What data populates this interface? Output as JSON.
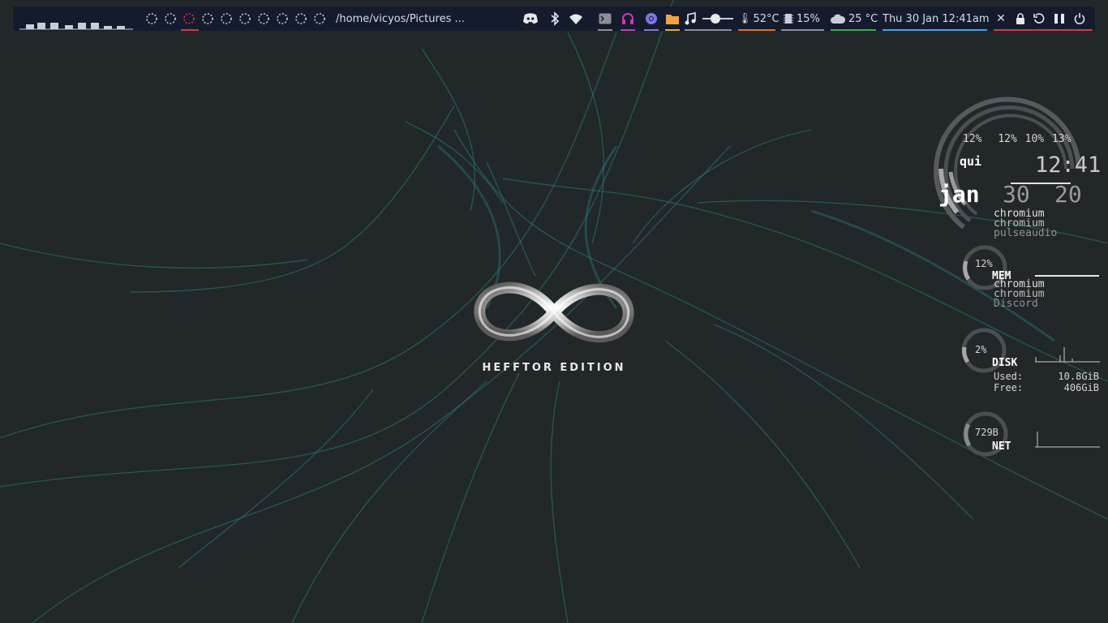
{
  "colors": {
    "bar_bg": "#141b2d",
    "accent_red": "#e0334a",
    "accent_orange": "#e8711f",
    "accent_green": "#3cb043",
    "accent_blue": "#3ea8e6",
    "accent_purple": "#7c78e6",
    "accent_magenta": "#c83cb4",
    "accent_yellow": "#f0a23c",
    "wallpaper_swirl": "#2a7a78"
  },
  "topbar": {
    "path": "/home/vicyos/Pictures ...",
    "icons": [
      "discord-icon",
      "bluetooth-icon",
      "wifi-icon",
      "terminal-icon",
      "headphones-icon",
      "chromium-icon",
      "folder-icon",
      "music-icon"
    ],
    "volume_level": 0.4,
    "temperature": "52°C",
    "memory": "15%",
    "weather": "25 °C",
    "datetime": "Thu 30 Jan 12:41am",
    "workspaces_count": 10,
    "active_workspace": 3
  },
  "logo": {
    "caption": "HEFFTOR EDITION"
  },
  "conky": {
    "cpu": {
      "cores": [
        "12%",
        "12%",
        "10%",
        "13%"
      ],
      "weekday": "qui",
      "time": "12:41",
      "month": "jan",
      "day": "30",
      "year": "20",
      "top": [
        "chromium",
        "chromium",
        "pulseaudio"
      ]
    },
    "mem": {
      "percent": "12%",
      "label": "MEM",
      "top": [
        "chromium",
        "chromium",
        "Discord"
      ]
    },
    "disk": {
      "percent": "2%",
      "label": "DISK",
      "used_label": "Used:",
      "used": "10.8GiB",
      "free_label": "Free:",
      "free": "406GiB"
    },
    "net": {
      "value": "729B",
      "label": "NET"
    }
  }
}
